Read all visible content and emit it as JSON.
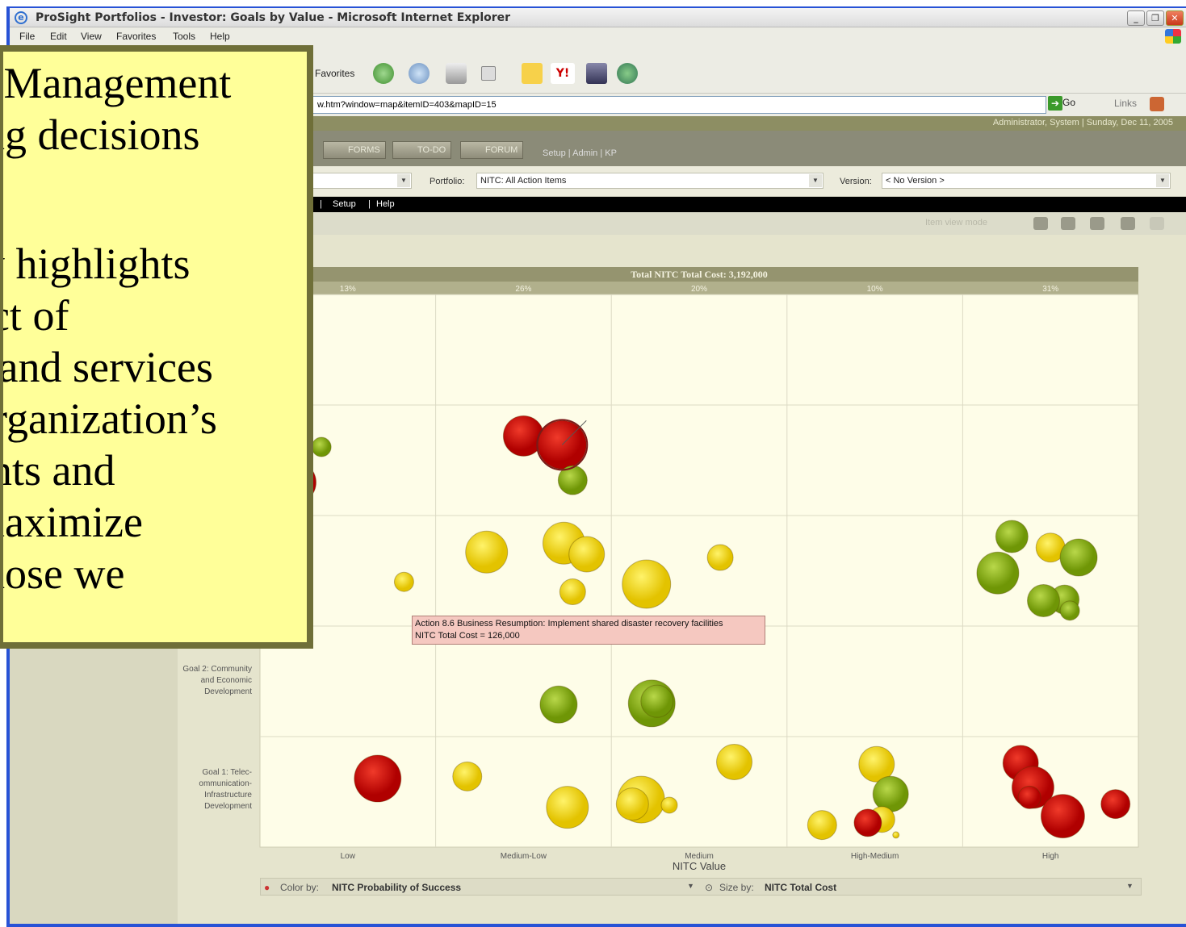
{
  "window": {
    "title": "ProSight Portfolios - Investor: Goals by Value - Microsoft Internet Explorer",
    "controls": [
      "_",
      "❐",
      "✕"
    ]
  },
  "menu": [
    "File",
    "Edit",
    "View",
    "Favorites",
    "Tools",
    "Help"
  ],
  "toolbar": {
    "favorites_label": "Favorites"
  },
  "address": {
    "url": "w.htm?window=map&itemID=403&mapID=15",
    "go_label": "Go",
    "links_label": "Links"
  },
  "app": {
    "user_status": "Administrator, System | Sunday, Dec 11, 2005",
    "tabs": [
      "FORMS",
      "TO-DO",
      "FORUM"
    ],
    "links": "Setup  |  Admin  |  KP",
    "portfolio_label": "Portfolio:",
    "portfolio_value": "NITC: All Action Items",
    "version_label": "Version:",
    "version_value": "< No Version >",
    "subbar_setup": "Setup",
    "subbar_help": "Help",
    "item_view_mode": "Item view mode"
  },
  "chart_data": {
    "type": "scatter",
    "title": "Total NITC Total Cost: 3,192,000",
    "xlabel": "NITC Value",
    "categories": [
      "Low",
      "Medium-Low",
      "Medium",
      "High-Medium",
      "High"
    ],
    "column_percentages": [
      "13%",
      "26%",
      "20%",
      "10%",
      "31%"
    ],
    "rows": [
      "",
      "",
      "",
      "Goal 2: Community and Economic Development",
      "Goal 1: Telec-ommunication-Infrastructure Development"
    ],
    "color_by": "NITC Probability of Success",
    "size_by": "NITC Total Cost",
    "colors": {
      "high": "#8db80a",
      "medium": "#f4e10e",
      "low": "#d50a0a"
    },
    "tooltip": {
      "line1": "Action 8.6 Business Resumption: Implement shared disaster recovery facilities",
      "line2": "NITC Total Cost = 126,000"
    },
    "bubbles": [
      {
        "col": 0,
        "row": 1,
        "xo": 0.35,
        "yo": 0.38,
        "r": 12,
        "c": "high"
      },
      {
        "col": 0,
        "row": 1,
        "xo": 0.02,
        "yo": 0.58,
        "r": 20,
        "c": "high"
      },
      {
        "col": 0,
        "row": 1,
        "xo": 0.2,
        "yo": 0.7,
        "r": 26,
        "c": "low"
      },
      {
        "col": 1,
        "row": 1,
        "xo": 0.5,
        "yo": 0.28,
        "r": 25,
        "c": "low"
      },
      {
        "col": 1,
        "row": 1,
        "xo": 0.72,
        "yo": 0.36,
        "r": 30,
        "c": "low"
      },
      {
        "col": 1,
        "row": 1,
        "xo": 0.78,
        "yo": 0.68,
        "r": 18,
        "c": "high"
      },
      {
        "col": 0,
        "row": 2,
        "xo": 0.82,
        "yo": 0.6,
        "r": 12,
        "c": "medium"
      },
      {
        "col": 1,
        "row": 2,
        "xo": 0.29,
        "yo": 0.33,
        "r": 26,
        "c": "medium"
      },
      {
        "col": 1,
        "row": 2,
        "xo": 0.73,
        "yo": 0.25,
        "r": 26,
        "c": "medium"
      },
      {
        "col": 1,
        "row": 2,
        "xo": 0.86,
        "yo": 0.35,
        "r": 22,
        "c": "medium"
      },
      {
        "col": 1,
        "row": 2,
        "xo": 0.78,
        "yo": 0.69,
        "r": 16,
        "c": "medium"
      },
      {
        "col": 2,
        "row": 2,
        "xo": 0.2,
        "yo": 0.62,
        "r": 30,
        "c": "medium"
      },
      {
        "col": 2,
        "row": 2,
        "xo": 0.62,
        "yo": 0.38,
        "r": 16,
        "c": "medium"
      },
      {
        "col": 4,
        "row": 2,
        "xo": 0.28,
        "yo": 0.19,
        "r": 20,
        "c": "high"
      },
      {
        "col": 4,
        "row": 2,
        "xo": 0.5,
        "yo": 0.29,
        "r": 18,
        "c": "medium"
      },
      {
        "col": 4,
        "row": 2,
        "xo": 0.66,
        "yo": 0.38,
        "r": 23,
        "c": "high"
      },
      {
        "col": 4,
        "row": 2,
        "xo": 0.2,
        "yo": 0.52,
        "r": 26,
        "c": "high"
      },
      {
        "col": 4,
        "row": 2,
        "xo": 0.58,
        "yo": 0.76,
        "r": 18,
        "c": "high"
      },
      {
        "col": 4,
        "row": 2,
        "xo": 0.46,
        "yo": 0.77,
        "r": 20,
        "c": "high"
      },
      {
        "col": 4,
        "row": 2,
        "xo": 0.61,
        "yo": 0.86,
        "r": 12,
        "c": "high"
      },
      {
        "col": 1,
        "row": 3,
        "xo": 0.7,
        "yo": 0.71,
        "r": 23,
        "c": "high"
      },
      {
        "col": 2,
        "row": 3,
        "xo": 0.23,
        "yo": 0.7,
        "r": 29,
        "c": "high"
      },
      {
        "col": 2,
        "row": 3,
        "xo": 0.26,
        "yo": 0.68,
        "r": 20,
        "c": "high"
      },
      {
        "col": 0,
        "row": 4,
        "xo": 0.67,
        "yo": 0.38,
        "r": 29,
        "c": "low"
      },
      {
        "col": 1,
        "row": 4,
        "xo": 0.18,
        "yo": 0.36,
        "r": 18,
        "c": "medium"
      },
      {
        "col": 1,
        "row": 4,
        "xo": 0.75,
        "yo": 0.64,
        "r": 26,
        "c": "medium"
      },
      {
        "col": 2,
        "row": 4,
        "xo": 0.7,
        "yo": 0.23,
        "r": 22,
        "c": "medium"
      },
      {
        "col": 2,
        "row": 4,
        "xo": 0.17,
        "yo": 0.57,
        "r": 29,
        "c": "medium"
      },
      {
        "col": 2,
        "row": 4,
        "xo": 0.12,
        "yo": 0.61,
        "r": 20,
        "c": "medium"
      },
      {
        "col": 2,
        "row": 4,
        "xo": 0.33,
        "yo": 0.62,
        "r": 10,
        "c": "medium"
      },
      {
        "col": 3,
        "row": 4,
        "xo": 0.51,
        "yo": 0.25,
        "r": 22,
        "c": "medium"
      },
      {
        "col": 3,
        "row": 4,
        "xo": 0.59,
        "yo": 0.52,
        "r": 22,
        "c": "high"
      },
      {
        "col": 3,
        "row": 4,
        "xo": 0.54,
        "yo": 0.75,
        "r": 16,
        "c": "medium"
      },
      {
        "col": 3,
        "row": 4,
        "xo": 0.46,
        "yo": 0.78,
        "r": 17,
        "c": "low"
      },
      {
        "col": 3,
        "row": 4,
        "xo": 0.2,
        "yo": 0.8,
        "r": 18,
        "c": "medium"
      },
      {
        "col": 3,
        "row": 4,
        "xo": 0.62,
        "yo": 0.89,
        "r": 4,
        "c": "medium"
      },
      {
        "col": 4,
        "row": 4,
        "xo": 0.33,
        "yo": 0.24,
        "r": 22,
        "c": "low"
      },
      {
        "col": 4,
        "row": 4,
        "xo": 0.4,
        "yo": 0.46,
        "r": 26,
        "c": "low"
      },
      {
        "col": 4,
        "row": 4,
        "xo": 0.38,
        "yo": 0.55,
        "r": 14,
        "c": "low"
      },
      {
        "col": 4,
        "row": 4,
        "xo": 0.57,
        "yo": 0.72,
        "r": 27,
        "c": "low"
      },
      {
        "col": 4,
        "row": 4,
        "xo": 0.87,
        "yo": 0.61,
        "r": 18,
        "c": "low"
      }
    ]
  },
  "note_lines": [
    "o Management",
    "ing decisions",
    "",
    "ly highlights",
    "act of",
    "s and services",
    "organization’s",
    "ents and",
    "maximize",
    "those we"
  ]
}
